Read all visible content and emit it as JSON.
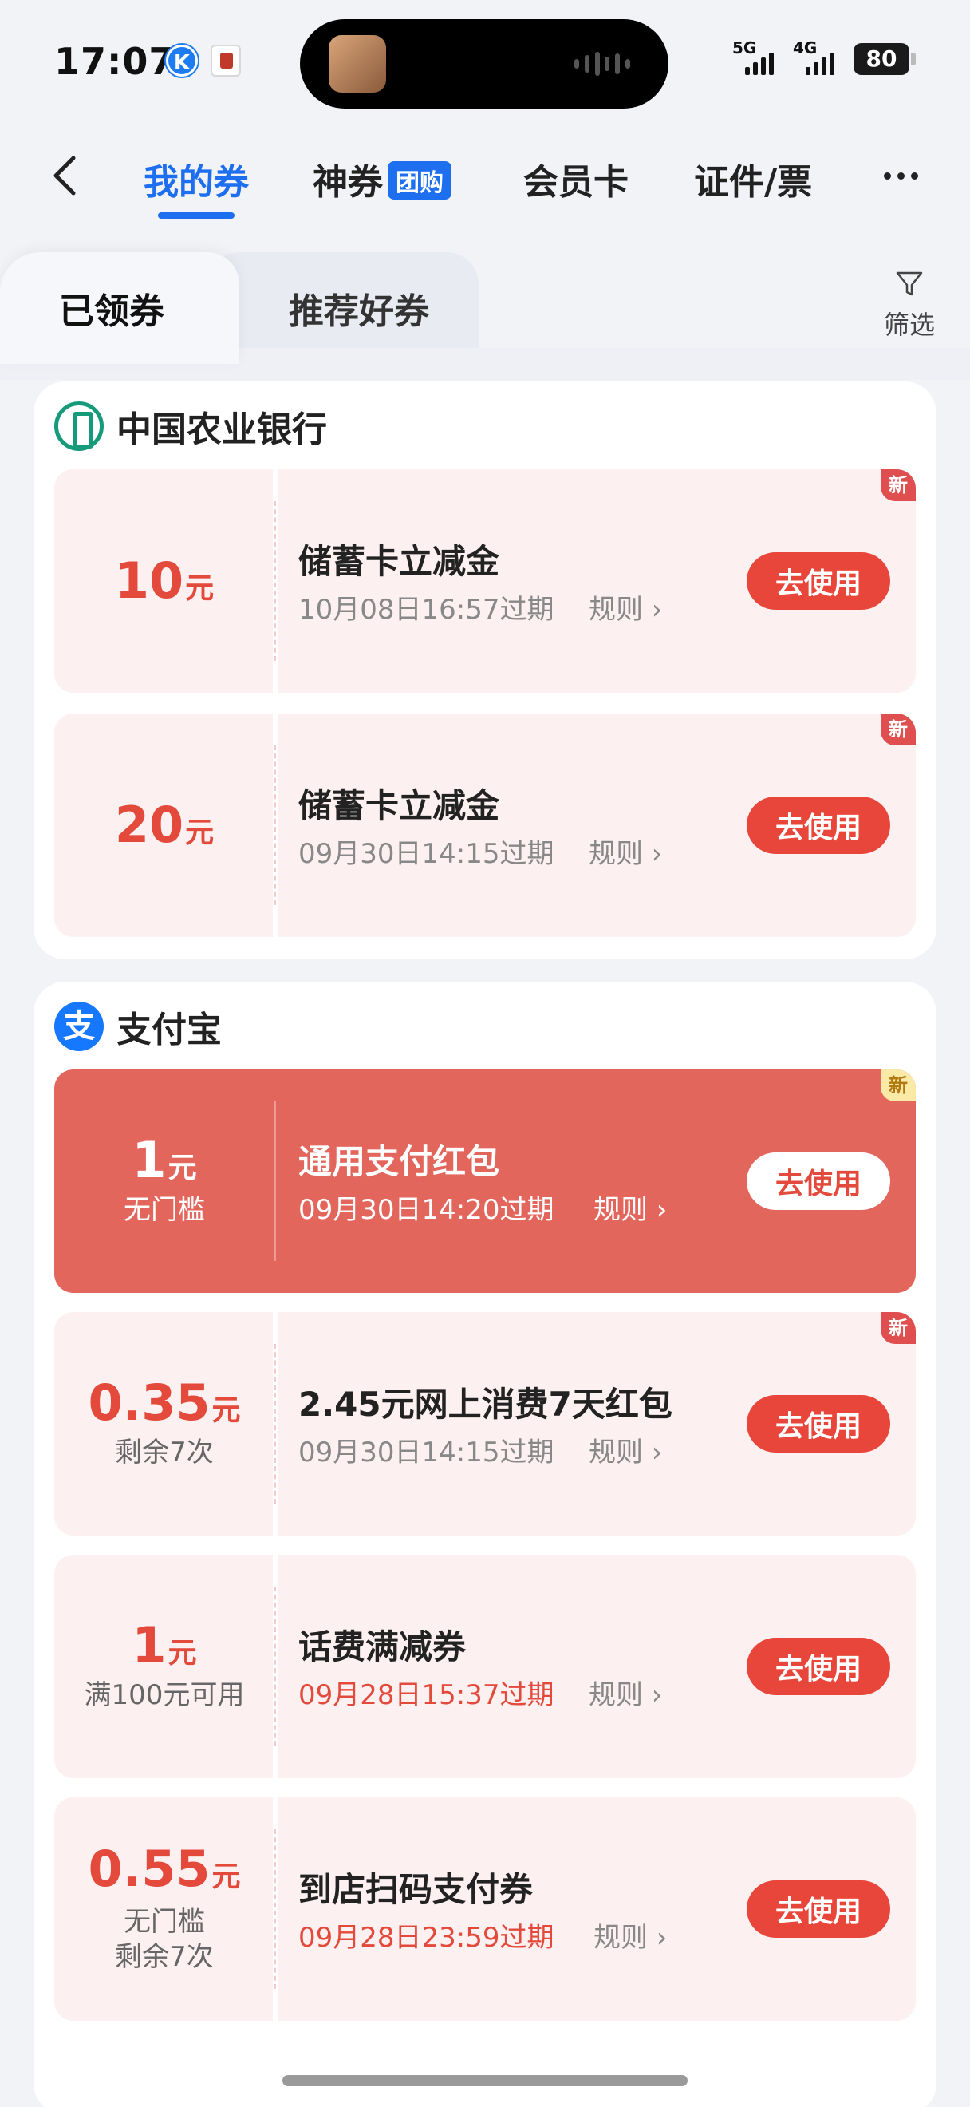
{
  "status_bar": {
    "time": "17:07",
    "k_icon": "K",
    "signal_1": "5G",
    "signal_2": "4G",
    "battery": "80"
  },
  "nav": {
    "tabs": [
      {
        "label": "我的券"
      },
      {
        "label": "神券",
        "tag": "团购"
      },
      {
        "label": "会员卡"
      },
      {
        "label": "证件/票"
      }
    ]
  },
  "subtabs": {
    "claimed": "已领券",
    "recommended": "推荐好券",
    "filter": "筛选"
  },
  "groups": [
    {
      "brand": "中国农业银行",
      "coupons": [
        {
          "amount": "10",
          "unit": "元",
          "title": "储蓄卡立减金",
          "expiry": "10月08日16:57过期",
          "rules": "规则",
          "button": "去使用",
          "badge": "新"
        },
        {
          "amount": "20",
          "unit": "元",
          "title": "储蓄卡立减金",
          "expiry": "09月30日14:15过期",
          "rules": "规则",
          "button": "去使用",
          "badge": "新"
        }
      ]
    },
    {
      "brand": "支付宝",
      "logo_char": "支",
      "coupons": [
        {
          "amount": "1",
          "unit": "元",
          "sub": "无门槛",
          "title": "通用支付红包",
          "expiry": "09月30日14:20过期",
          "rules": "规则",
          "button": "去使用",
          "badge": "新"
        },
        {
          "amount": "0.35",
          "unit": "元",
          "sub": "剩余7次",
          "title": "2.45元网上消费7天红包",
          "expiry": "09月30日14:15过期",
          "rules": "规则",
          "button": "去使用",
          "badge": "新"
        },
        {
          "amount": "1",
          "unit": "元",
          "sub": "满100元可用",
          "title": "话费满减券",
          "expiry": "09月28日15:37过期",
          "rules": "规则",
          "button": "去使用"
        },
        {
          "amount": "0.55",
          "unit": "元",
          "sub": "无门槛",
          "sub2": "剩余7次",
          "title": "到店扫码支付券",
          "expiry": "09月28日23:59过期",
          "rules": "规则",
          "button": "去使用"
        }
      ]
    }
  ],
  "colors": {
    "accent_blue": "#1e6ff0",
    "coupon_red": "#e34a3b",
    "coupon_bg": "#fdf0f1",
    "highlight_bg": "#e3665c"
  }
}
